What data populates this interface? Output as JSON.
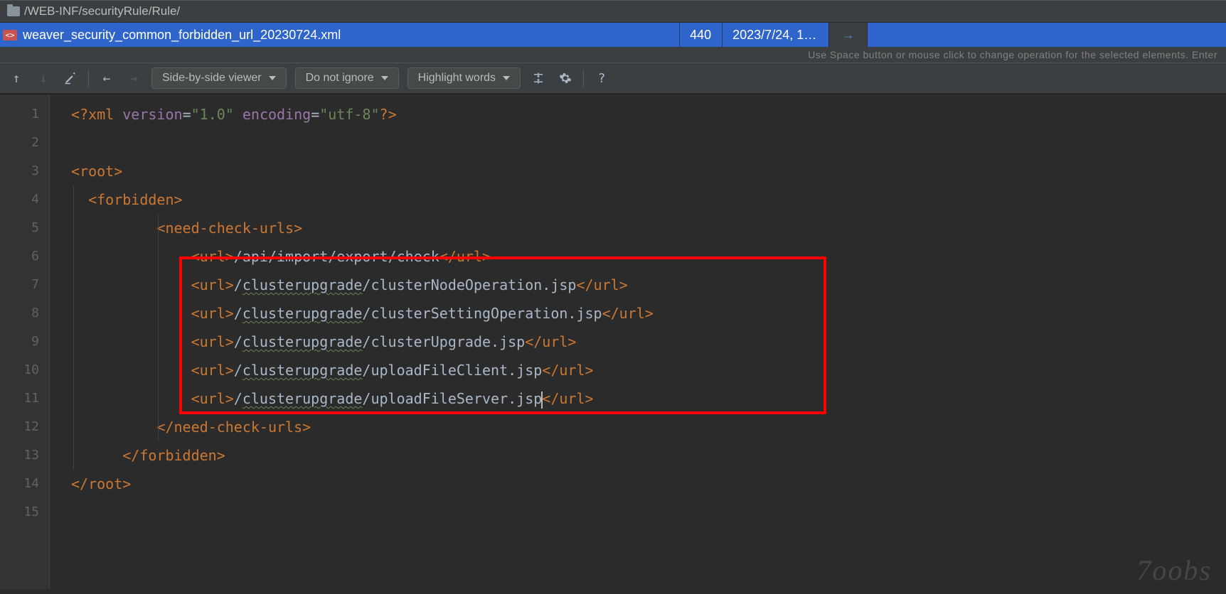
{
  "breadcrumb": "/WEB-INF/securityRule/Rule/",
  "file": {
    "name": "weaver_security_common_forbidden_url_20230724.xml",
    "size": "440",
    "date": "2023/7/24, 1…"
  },
  "hint": "Use Space button or mouse click to change operation for the selected elements. Enter",
  "toolbar": {
    "dd_viewer": "Side-by-side viewer",
    "dd_ignore": "Do not ignore",
    "dd_highlight": "Highlight words"
  },
  "gutter_lines": [
    "1",
    "2",
    "3",
    "4",
    "5",
    "6",
    "7",
    "8",
    "9",
    "10",
    "11",
    "12",
    "13",
    "14",
    "15"
  ],
  "code": {
    "l1_pi_start": "<?",
    "l1_pi_name": "xml",
    "l1_pi_attr1": "version",
    "l1_pi_val1": "\"1.0\"",
    "l1_pi_attr2": "encoding",
    "l1_pi_val2": "\"utf-8\"",
    "l1_pi_end": "?>",
    "l3_root_open": "<root>",
    "l4_forbidden_open": "<forbidden>",
    "l5_ncu_open": "<need-check-urls>",
    "l6_url_text": "/api/import/export/check",
    "l7_url_pre": "/",
    "l7_url_wavy": "clusterupgrade",
    "l7_url_rest": "/clusterNodeOperation.jsp",
    "l8_url_pre": "/",
    "l8_url_wavy": "clusterupgrade",
    "l8_url_rest": "/clusterSettingOperation.jsp",
    "l9_url_pre": "/",
    "l9_url_wavy": "clusterupgrade",
    "l9_url_rest": "/clusterUpgrade.jsp",
    "l10_url_pre": "/",
    "l10_url_wavy": "clusterupgrade",
    "l10_url_rest": "/uploadFileClient.jsp",
    "l11_url_pre": "/",
    "l11_url_wavy": "clusterupgrade",
    "l11_url_rest": "/uploadFileServer.jsp",
    "l12_ncu_close": "</need-check-urls>",
    "l13_forbidden_close": "</forbidden>",
    "l14_root_close": "</root>",
    "url_tag_open": "<url>",
    "url_tag_close": "</url>"
  },
  "watermark": "7oobs"
}
